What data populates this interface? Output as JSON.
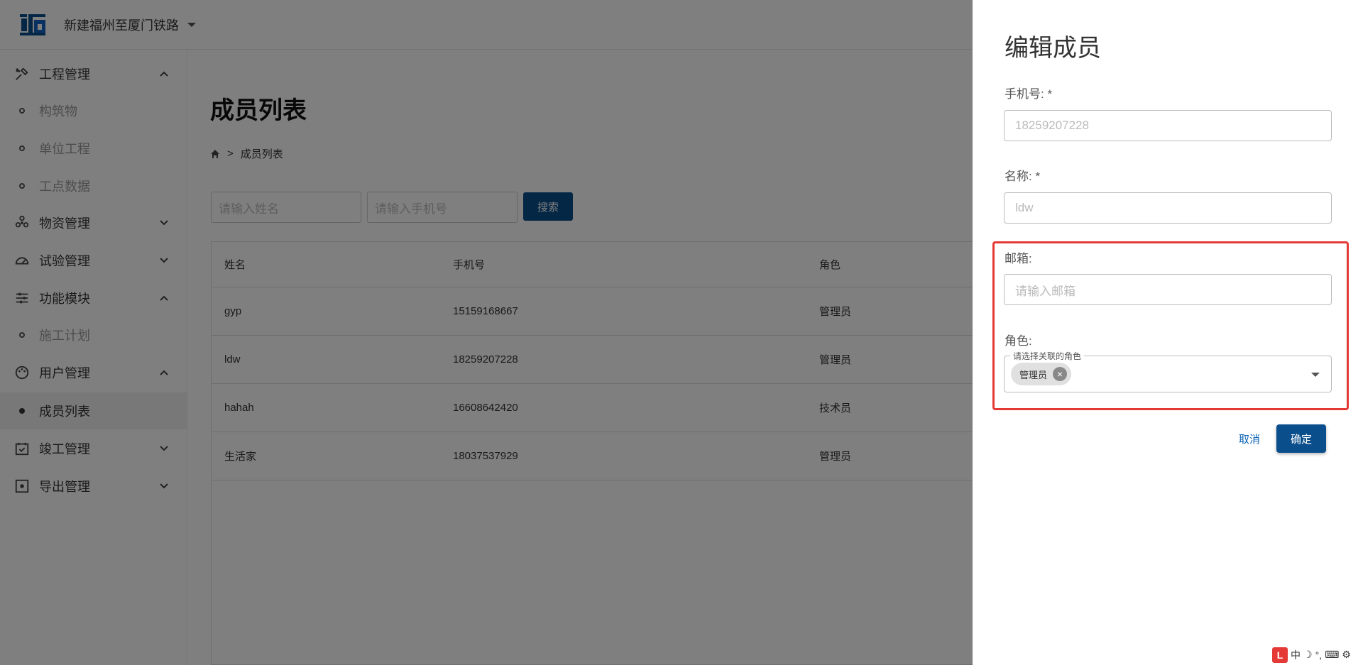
{
  "header": {
    "project_name": "新建福州至厦门铁路"
  },
  "sidebar": {
    "items": [
      {
        "label": "工程管理",
        "icon": "tools-icon",
        "expanded": true
      },
      {
        "label": "构筑物"
      },
      {
        "label": "单位工程"
      },
      {
        "label": "工点数据"
      },
      {
        "label": "物资管理",
        "icon": "hexagon-cluster-icon",
        "expanded": false
      },
      {
        "label": "试验管理",
        "icon": "gauge-icon",
        "expanded": false
      },
      {
        "label": "功能模块",
        "icon": "sliders-icon",
        "expanded": true
      },
      {
        "label": "施工计划"
      },
      {
        "label": "用户管理",
        "icon": "palette-icon",
        "expanded": true
      },
      {
        "label": "成员列表"
      },
      {
        "label": "竣工管理",
        "icon": "calendar-check-icon",
        "expanded": false
      },
      {
        "label": "导出管理",
        "icon": "export-box-icon",
        "expanded": false
      }
    ]
  },
  "main": {
    "title": "成员列表",
    "breadcrumb": "成员列表",
    "search": {
      "name_placeholder": "请输入姓名",
      "phone_placeholder": "请输入手机号",
      "button": "搜索"
    },
    "table": {
      "columns": [
        "姓名",
        "手机号",
        "角色"
      ],
      "rows": [
        [
          "gyp",
          "15159168667",
          "管理员"
        ],
        [
          "ldw",
          "18259207228",
          "管理员"
        ],
        [
          "hahah",
          "16608642420",
          "技术员"
        ],
        [
          "生活家",
          "18037537929",
          "管理员"
        ]
      ]
    }
  },
  "drawer": {
    "title": "编辑成员",
    "phone_label": "手机号: *",
    "phone_value": "18259207228",
    "name_label": "名称: *",
    "name_value": "ldw",
    "email_label": "邮箱:",
    "email_placeholder": "请输入邮箱",
    "role_label": "角色:",
    "role_legend": "请选择关联的角色",
    "role_chip": "管理员",
    "cancel": "取消",
    "confirm": "确定"
  },
  "ime": {
    "mode": "中"
  },
  "colors": {
    "primary": "#0b4e8c",
    "highlight": "#e53935",
    "link": "#0b63b6"
  }
}
